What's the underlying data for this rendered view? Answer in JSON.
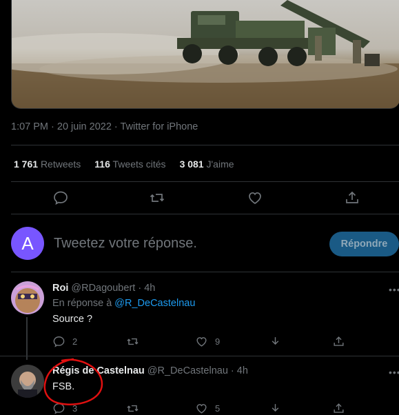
{
  "tweet": {
    "meta": "1:07 PM · 20 juin 2022 · Twitter for iPhone",
    "stats": [
      {
        "value": "1 761",
        "label": "Retweets"
      },
      {
        "value": "116",
        "label": "Tweets cités"
      },
      {
        "value": "3 081",
        "label": "J'aime"
      }
    ],
    "actions": [
      "reply-icon",
      "retweet-icon",
      "like-icon",
      "share-icon"
    ]
  },
  "composer": {
    "avatar_letter": "A",
    "placeholder": "Tweetez votre réponse.",
    "button_label": "Répondre"
  },
  "replies": [
    {
      "name": "Roi",
      "handle": "@RDagoubert",
      "sep": "·",
      "time": "4h",
      "reply_prefix": "En réponse à ",
      "reply_to": "@R_DeCastelnau",
      "text": "Source ?",
      "reply_count": "2",
      "retweet_count": "",
      "like_count": "9"
    },
    {
      "name": "Régis de Castelnau",
      "handle": "@R_DeCastelnau",
      "sep": "·",
      "time": "4h",
      "text": "FSB.",
      "reply_count": "3",
      "retweet_count": "",
      "like_count": "5"
    }
  ],
  "colors": {
    "background": "#000000",
    "accent": "#1d9bf0",
    "muted": "#71767b",
    "annotation": "#e01010"
  }
}
